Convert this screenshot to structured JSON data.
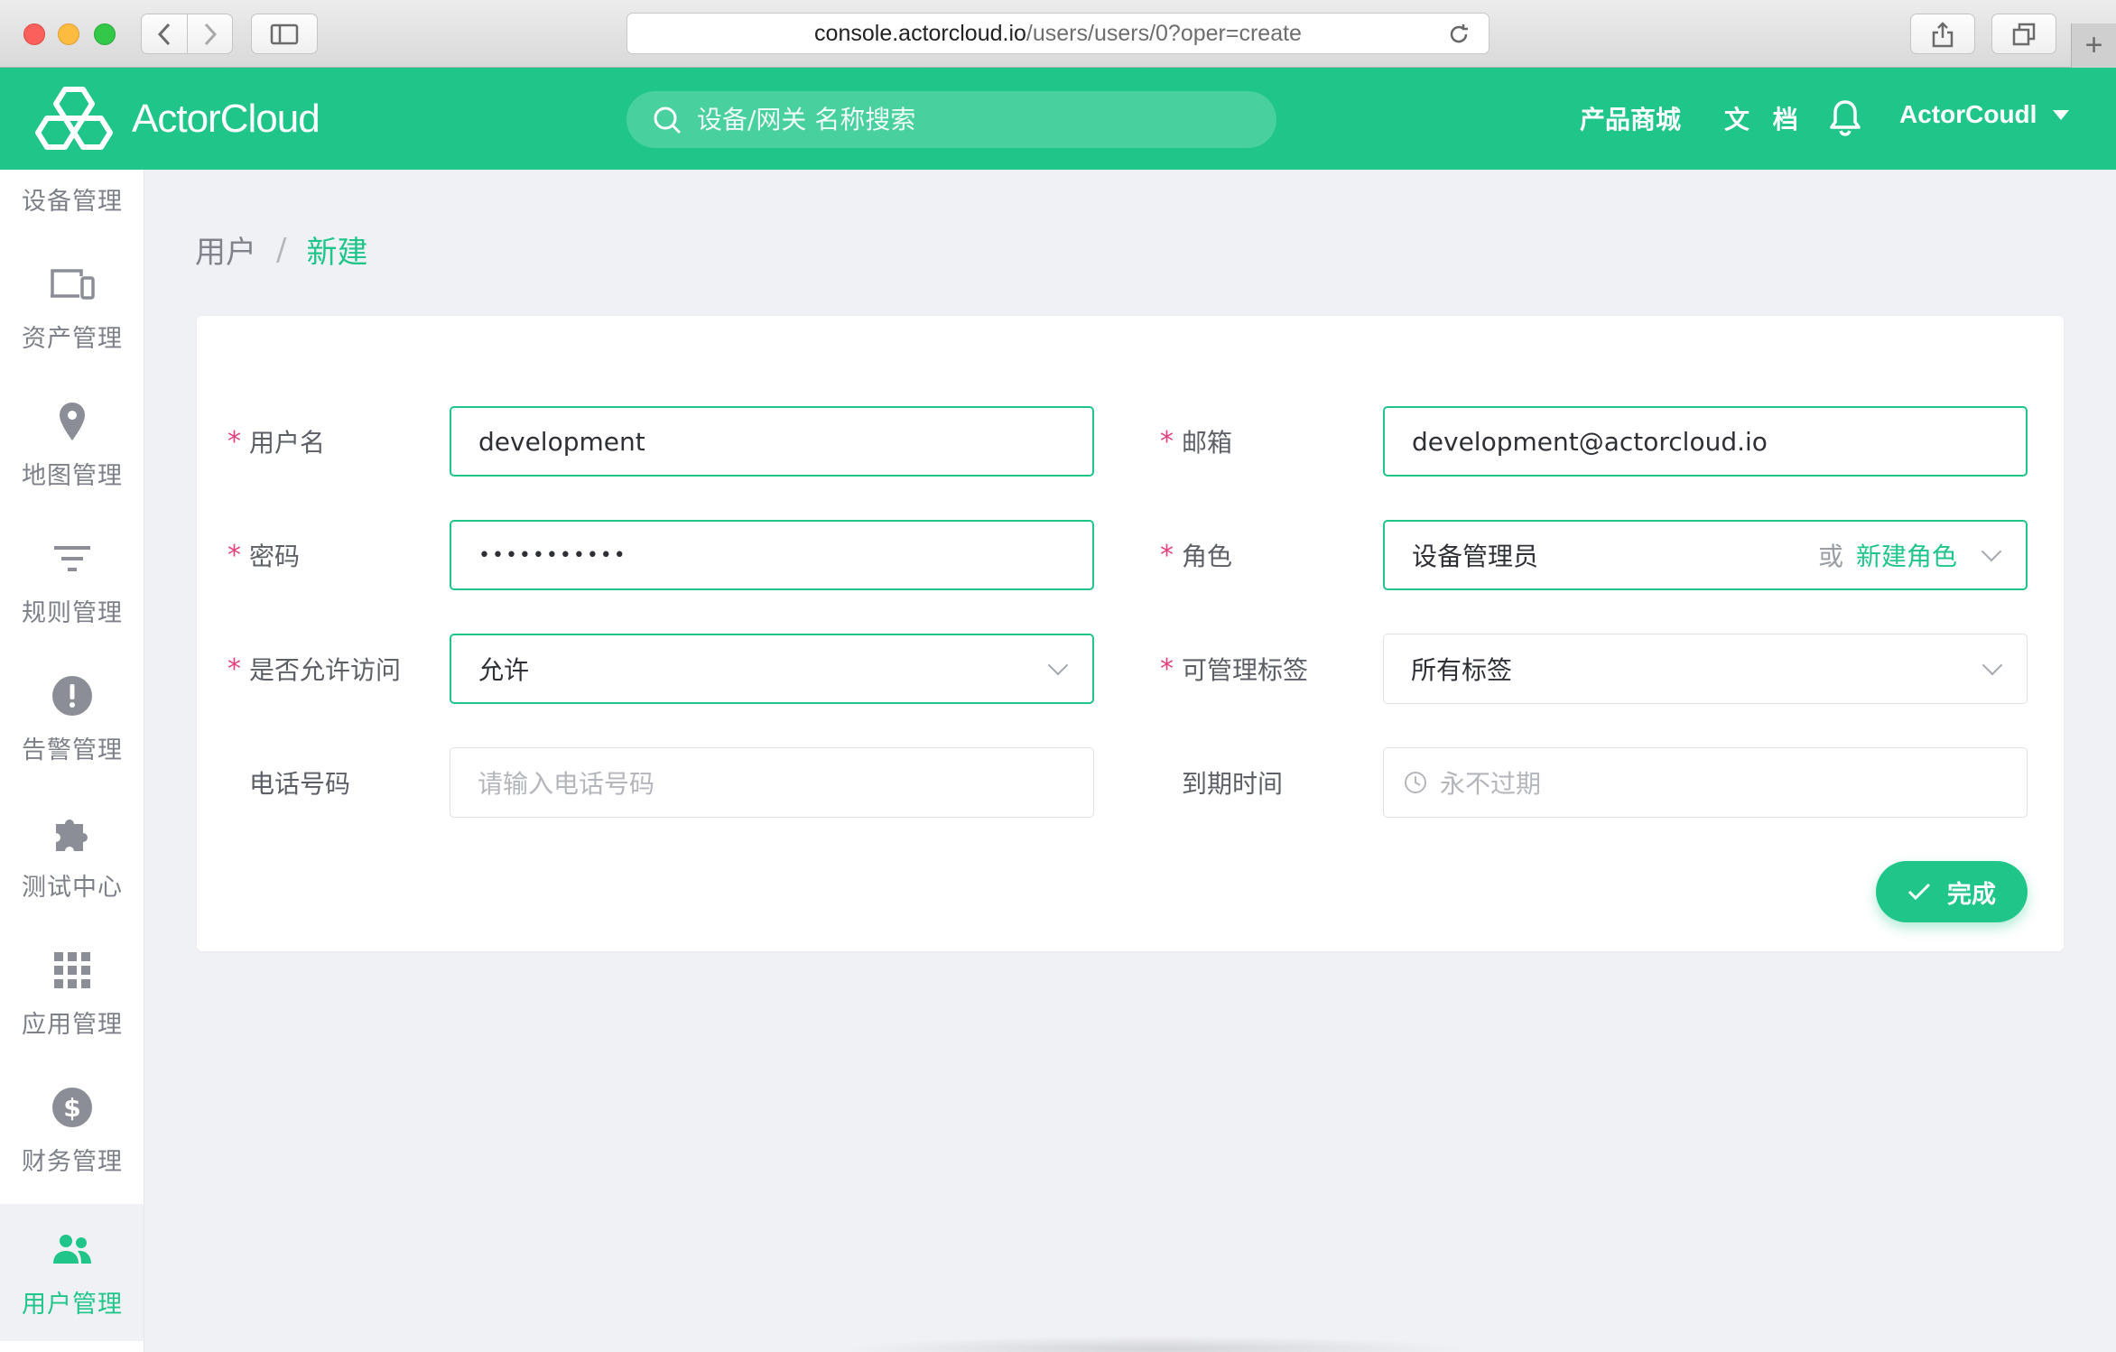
{
  "browser": {
    "url_host": "console.actorcloud.io",
    "url_path": "/users/users/0?oper=create",
    "new_tab": "+"
  },
  "header": {
    "logo_text": "ActorCloud",
    "search_placeholder": "设备/网关 名称搜索",
    "store_link": "产品商城",
    "docs_link": "文 档",
    "user_name": "ActorCoudl"
  },
  "sidebar": {
    "items": [
      {
        "label": "设备管理",
        "icon": "devices-icon"
      },
      {
        "label": "资产管理",
        "icon": "assets-icon"
      },
      {
        "label": "地图管理",
        "icon": "map-pin-icon"
      },
      {
        "label": "规则管理",
        "icon": "filter-icon"
      },
      {
        "label": "告警管理",
        "icon": "alert-icon"
      },
      {
        "label": "测试中心",
        "icon": "puzzle-icon"
      },
      {
        "label": "应用管理",
        "icon": "apps-grid-icon"
      },
      {
        "label": "财务管理",
        "icon": "dollar-icon"
      },
      {
        "label": "用户管理",
        "icon": "users-icon",
        "active": true
      }
    ]
  },
  "breadcrumb": {
    "parent": "用户",
    "separator": "/",
    "current": "新建"
  },
  "form": {
    "username": {
      "label": "用户名",
      "value": "development",
      "required": true
    },
    "email": {
      "label": "邮箱",
      "value": "development@actorcloud.io",
      "required": true
    },
    "password": {
      "label": "密码",
      "value": "•••••••••••",
      "required": true
    },
    "role": {
      "label": "角色",
      "value": "设备管理员",
      "or_text": "或",
      "new_role_link": "新建角色",
      "required": true
    },
    "access": {
      "label": "是否允许访问",
      "value": "允许",
      "required": true
    },
    "tags": {
      "label": "可管理标签",
      "value": "所有标签",
      "required": true
    },
    "phone": {
      "label": "电话号码",
      "placeholder": "请输入电话号码",
      "required": false
    },
    "expiry": {
      "label": "到期时间",
      "placeholder": "永不过期",
      "required": false
    },
    "submit_label": "完成"
  },
  "colors": {
    "brand": "#20c689",
    "required_asterisk": "#e2417d"
  }
}
